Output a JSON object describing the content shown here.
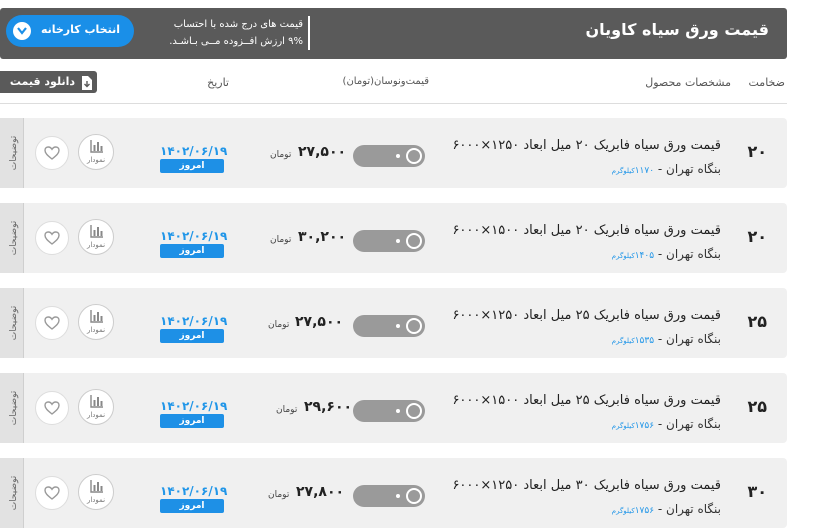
{
  "header": {
    "title": "قیمت ورق سیاه کاویان",
    "note_line1": "قیمت های درج شده با احتساب",
    "note_line2": "۹% ارزش افــزوده مــی بـاشـد.",
    "select_label": "انتخاب کارخانه",
    "download_label": "دانلود قیمت"
  },
  "columns": {
    "thickness": "ضخامت",
    "specs": "مشخصات محصول",
    "price": "قیمت‌ونوسان(تومان)",
    "date": "تاریخ"
  },
  "row_common": {
    "description_tab": "توضیحات",
    "chart_label": "نمودار",
    "today_badge": "امروز",
    "currency": "تومان"
  },
  "rows": [
    {
      "thickness": "۲۰",
      "name": "قیمت ورق سیاه فابریک ۲۰ میل ابعاد ۱۲۵۰×۶۰۰۰",
      "warehouse": "بنگاه تهران - ",
      "weight": "۱۱۷۰",
      "weight_unit": "کیلوگرم",
      "price": "۲۷,۵۰۰",
      "date": "۱۴۰۲/۰۶/۱۹"
    },
    {
      "thickness": "۲۰",
      "name": "قیمت ورق سیاه فابریک ۲۰ میل ابعاد ۱۵۰۰×۶۰۰۰",
      "warehouse": "بنگاه تهران - ",
      "weight": "۱۴۰۵",
      "weight_unit": "کیلوگرم",
      "price": "۳۰,۲۰۰",
      "date": "۱۴۰۲/۰۶/۱۹"
    },
    {
      "thickness": "۲۵",
      "name": "قیمت ورق سیاه فابریک ۲۵ میل ابعاد ۱۲۵۰×۶۰۰۰",
      "warehouse": "بنگاه تهران - ",
      "weight": "۱۵۳۵",
      "weight_unit": "کیلوگرم",
      "price": "۲۷,۵۰۰",
      "date": "۱۴۰۲/۰۶/۱۹"
    },
    {
      "thickness": "۲۵",
      "name": "قیمت ورق سیاه فابریک ۲۵ میل ابعاد ۱۵۰۰×۶۰۰۰",
      "warehouse": "بنگاه تهران - ",
      "weight": "۱۷۵۶",
      "weight_unit": "کیلوگرم",
      "price": "۲۹,۶۰۰",
      "date": "۱۴۰۲/۰۶/۱۹"
    },
    {
      "thickness": "۳۰",
      "name": "قیمت ورق سیاه فابریک ۳۰ میل ابعاد ۱۲۵۰×۶۰۰۰",
      "warehouse": "بنگاه تهران - ",
      "weight": "۱۷۵۶",
      "weight_unit": "کیلوگرم",
      "price": "۲۷,۸۰۰",
      "date": "۱۴۰۲/۰۶/۱۹"
    }
  ],
  "colors": {
    "header_bg": "#5a5a5a",
    "accent": "#1a8fe8",
    "row_bg": "#f0f0f0",
    "toggle": "#9a9a9a"
  },
  "icons": {
    "select": "chevron-down-icon",
    "download": "download-file-icon",
    "chart": "bar-chart-icon",
    "favorite": "heart-icon"
  }
}
